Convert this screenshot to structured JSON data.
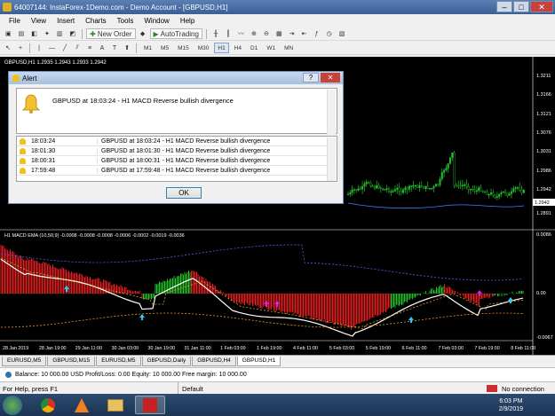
{
  "window": {
    "title": "64007144: InstaForex-1Demo.com - Demo Account - [GBPUSD,H1]",
    "minimize": "–",
    "maximize": "□",
    "close": "✕"
  },
  "menu": [
    "File",
    "View",
    "Insert",
    "Charts",
    "Tools",
    "Window",
    "Help"
  ],
  "toolbar1": {
    "new_order": "New Order",
    "auto_trading": "AutoTrading"
  },
  "timeframes": [
    "M1",
    "M5",
    "M15",
    "M30",
    "H1",
    "H4",
    "D1",
    "W1",
    "MN"
  ],
  "active_timeframe": "H1",
  "chart": {
    "symbol_header": "GBPUSD,H1  1.2935 1.2943 1.2933 1.2942",
    "price_labels": [
      "1.3211",
      "1.3166",
      "1.3121",
      "1.3076",
      "1.3031",
      "1.2986",
      "1.2942",
      "1.2891"
    ],
    "current_price": "1.2942",
    "indicator_header": "H1 MACD EMA (10,50,9) -0.0008 -0.0008 -0.0008 -0.0006 -0.0002 -0.0019 -0.0036",
    "indicator_labels": [
      "0.0086",
      "0.00",
      "-0.0067"
    ],
    "time_labels": [
      "28 Jan 2019",
      "28 Jan 19:00",
      "29 Jan 11:00",
      "30 Jan 03:00",
      "30 Jan 19:00",
      "31 Jan 11:00",
      "1 Feb 03:00",
      "1 Feb 19:00",
      "4 Feb 11:00",
      "5 Feb 03:00",
      "5 Feb 19:00",
      "6 Feb 11:00",
      "7 Feb 03:00",
      "7 Feb 19:00",
      "8 Feb 11:00"
    ]
  },
  "alert": {
    "title": "Alert",
    "help": "?",
    "close": "✕",
    "message": "GBPUSD at 18:03:24 - H1 MACD Reverse bullish divergence",
    "rows": [
      {
        "time": "18:03:24",
        "msg": "GBPUSD at 18:03:24 - H1 MACD Reverse bullish divergence"
      },
      {
        "time": "18:01:30",
        "msg": "GBPUSD at 18:01:30 - H1 MACD Reverse bullish divergence"
      },
      {
        "time": "18:00:31",
        "msg": "GBPUSD at 18:00:31 - H1 MACD Reverse bullish divergence"
      },
      {
        "time": "17:59:48",
        "msg": "GBPUSD at 17:59:48 - H1 MACD Reverse bullish divergence"
      }
    ],
    "ok": "OK"
  },
  "tabs": [
    "EURUSD,M5",
    "GBPUSD,M15",
    "EURUSD,M5",
    "GBPUSD,Daily",
    "GBPUSD,H4",
    "GBPUSD,H1"
  ],
  "active_tab": "GBPUSD,H1",
  "balance_line": "Balance: 10 000.00 USD  Profit/Loss: 0.00  Equity: 10 000.00  Free margin: 10 000.00",
  "status": {
    "help": "For Help, press F1",
    "profile": "Default",
    "connection": "No connection"
  },
  "taskbar": {
    "time": "6:03 PM",
    "date": "2/9/2019"
  },
  "colors": {
    "chart_bg": "#000000",
    "bull": "#22c02a",
    "bear": "#e02020",
    "macd": "#ffffff",
    "signal": "#2050ff"
  }
}
